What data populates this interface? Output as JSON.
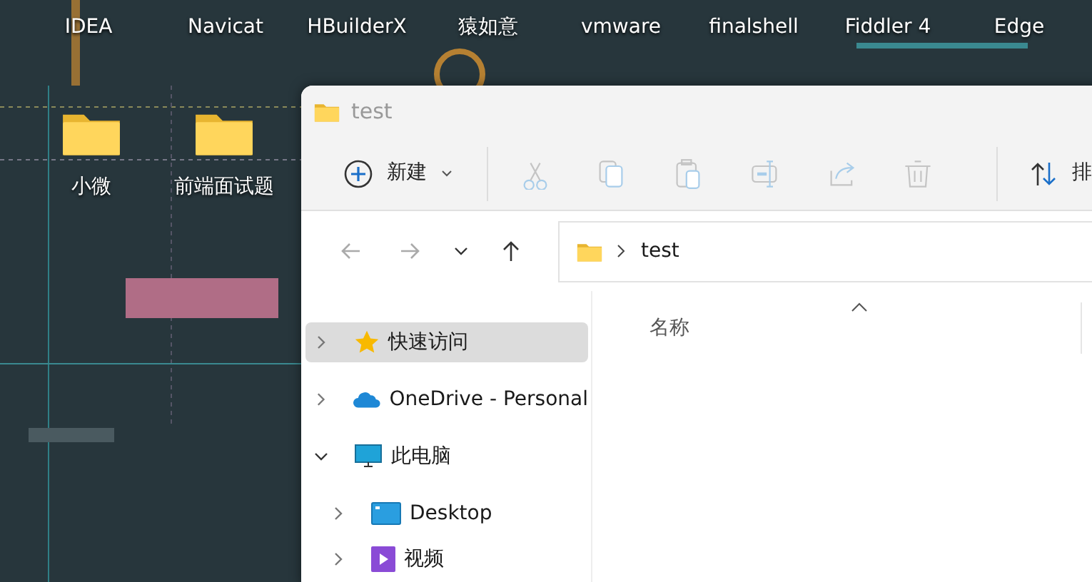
{
  "desktop": {
    "shortcuts": [
      {
        "label": "IDEA"
      },
      {
        "label": "Navicat"
      },
      {
        "label": "HBuilderX"
      },
      {
        "label": "猿如意"
      },
      {
        "label": "vmware"
      },
      {
        "label": "finalshell"
      },
      {
        "label": "Fiddler 4"
      },
      {
        "label": "Edge"
      }
    ],
    "folders": [
      {
        "label": "小微"
      },
      {
        "label": "前端面试题"
      }
    ]
  },
  "window": {
    "title": "test",
    "toolbar": {
      "new_button": {
        "label": "新建"
      },
      "actions": [
        {
          "kind": "cut",
          "disabled": true
        },
        {
          "kind": "copy",
          "disabled": true
        },
        {
          "kind": "paste",
          "disabled": true
        },
        {
          "kind": "rename",
          "disabled": true
        },
        {
          "kind": "share",
          "disabled": true
        },
        {
          "kind": "delete",
          "disabled": true
        }
      ],
      "sort_button": {
        "label": "排"
      }
    },
    "navigation": [
      {
        "kind": "back",
        "disabled": true
      },
      {
        "kind": "forward",
        "disabled": true
      },
      {
        "kind": "recent",
        "disabled": false
      },
      {
        "kind": "up",
        "disabled": false
      }
    ],
    "address": {
      "path": "test"
    },
    "sidebar": {
      "items": [
        {
          "label": "快速访问",
          "kind": "star",
          "selected": true,
          "expanded": false
        },
        {
          "label": "OneDrive - Personal",
          "kind": "cloud",
          "selected": false,
          "expanded": false
        },
        {
          "label": "此电脑",
          "kind": "pc",
          "selected": false,
          "expanded": true,
          "children": [
            {
              "label": "Desktop",
              "kind": "desktop",
              "selected": false,
              "expanded": false
            },
            {
              "label": "视频",
              "kind": "video",
              "selected": false,
              "expanded": false
            }
          ]
        }
      ]
    },
    "columns": [
      {
        "label": "名称"
      }
    ]
  }
}
